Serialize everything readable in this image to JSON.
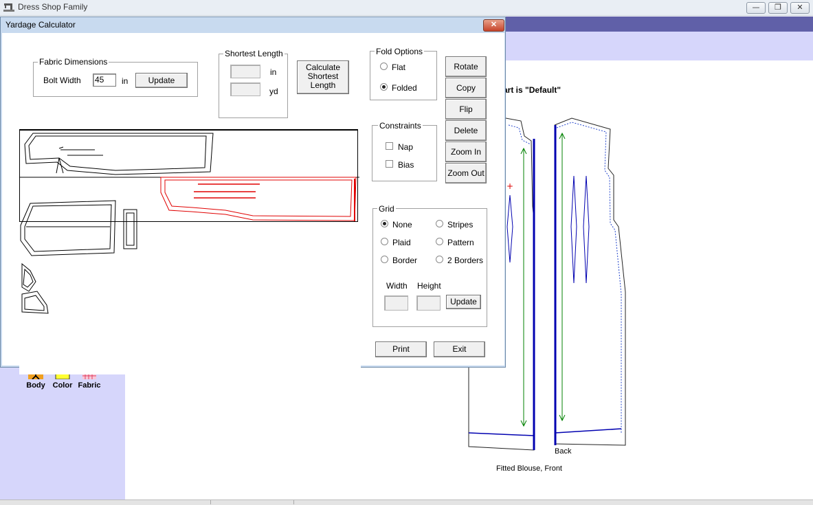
{
  "main_window": {
    "title": "Dress Shop Family",
    "controls": {
      "minimize": "—",
      "restore": "❐",
      "close": "✕"
    }
  },
  "tools": [
    {
      "label": "Body",
      "icon": "body-icon"
    },
    {
      "label": "Color",
      "icon": "color-swatch-icon"
    },
    {
      "label": "Fabric",
      "icon": "fabric-grid-icon"
    }
  ],
  "canvas": {
    "chart_label": "art is \"Default\"",
    "back_label": "Back",
    "caption": "Fitted Blouse, Front"
  },
  "dialog": {
    "title": "Yardage Calculator",
    "close": "✕",
    "fabric_dimensions": {
      "legend": "Fabric Dimensions",
      "bolt_width_label": "Bolt Width",
      "bolt_width_value": "45",
      "unit": "in",
      "update": "Update"
    },
    "shortest_length": {
      "legend": "Shortest Length",
      "unit_in": "in",
      "unit_yd": "yd",
      "value_in": "",
      "value_yd": ""
    },
    "calculate_button": "Calculate Shortest Length",
    "fold_options": {
      "legend": "Fold Options",
      "flat": "Flat",
      "folded": "Folded",
      "selected": "Folded"
    },
    "constraints": {
      "legend": "Constraints",
      "nap": "Nap",
      "bias": "Bias"
    },
    "side_buttons": [
      "Rotate",
      "Copy",
      "Flip",
      "Delete",
      "Zoom In",
      "Zoom Out"
    ],
    "grid": {
      "legend": "Grid",
      "options": [
        "None",
        "Stripes",
        "Plaid",
        "Pattern",
        "Border",
        "2 Borders"
      ],
      "selected": "None",
      "width_label": "Width",
      "height_label": "Height",
      "update": "Update"
    },
    "print": "Print",
    "exit": "Exit"
  },
  "colors": {
    "menubar": "#6060a8",
    "panel": "#d6d6fb",
    "selected_piece": "#e00000",
    "pattern_line": "#0000b0",
    "grainline": "#008000"
  }
}
